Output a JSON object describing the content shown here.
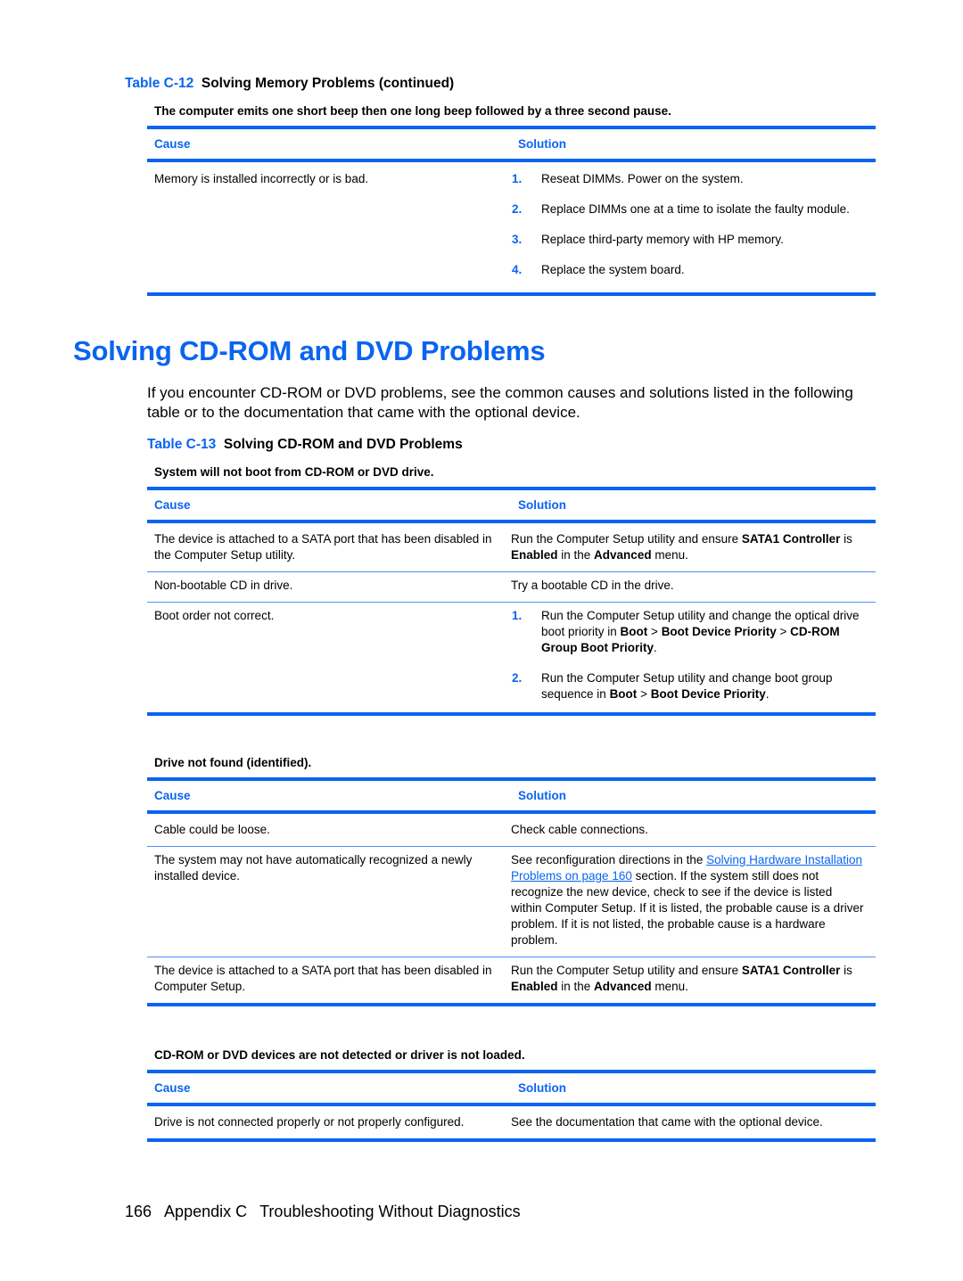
{
  "table_c12": {
    "caption_num": "Table C-12",
    "caption_title": "Solving Memory Problems (continued)",
    "subtitle": "The computer emits one short beep then one long beep followed by a three second pause.",
    "header": {
      "cause": "Cause",
      "solution": "Solution"
    },
    "row": {
      "cause": "Memory is installed incorrectly or is bad.",
      "steps": [
        {
          "n": "1.",
          "text": "Reseat DIMMs. Power on the system."
        },
        {
          "n": "2.",
          "text": "Replace DIMMs one at a time to isolate the faulty module."
        },
        {
          "n": "3.",
          "text": "Replace third-party memory with HP memory."
        },
        {
          "n": "4.",
          "text": "Replace the system board."
        }
      ]
    }
  },
  "section": {
    "title": "Solving CD-ROM and DVD Problems",
    "intro": "If you encounter CD-ROM or DVD problems, see the common causes and solutions listed in the following table or to the documentation that came with the optional device."
  },
  "table_c13": {
    "caption_num": "Table C-13",
    "caption_title": "Solving CD-ROM and DVD Problems",
    "groups": [
      {
        "subtitle": "System will not boot from CD-ROM or DVD drive.",
        "header": {
          "cause": "Cause",
          "solution": "Solution"
        },
        "rows": [
          {
            "cause": "The device is attached to a SATA port that has been disabled in the Computer Setup utility.",
            "sol": {
              "a": "Run the Computer Setup utility and ensure ",
              "b1": "SATA1 Controller",
              "c": " is ",
              "b2": "Enabled",
              "d": " in the ",
              "b3": "Advanced",
              "e": " menu."
            }
          },
          {
            "cause": "Non-bootable CD in drive.",
            "solution": "Try a bootable CD in the drive."
          },
          {
            "cause": "Boot order not correct.",
            "steps": [
              {
                "n": "1.",
                "a": "Run the Computer Setup utility and change the optical drive boot priority in ",
                "b1": "Boot",
                "sep1": " > ",
                "b2": "Boot Device Priority",
                "sep2": " > ",
                "b3": "CD-ROM Group Boot Priority",
                "end": "."
              },
              {
                "n": "2.",
                "a": "Run the Computer Setup utility and change boot group sequence in ",
                "b1": "Boot",
                "sep1": " > ",
                "b2": "Boot Device Priority",
                "end": "."
              }
            ]
          }
        ]
      },
      {
        "subtitle": "Drive not found (identified).",
        "header": {
          "cause": "Cause",
          "solution": "Solution"
        },
        "rows": [
          {
            "cause": "Cable could be loose.",
            "solution": "Check cable connections."
          },
          {
            "cause": "The system may not have automatically recognized a newly installed device.",
            "sol": {
              "a": "See reconfiguration directions in the ",
              "link": "Solving Hardware Installation Problems on page 160",
              "b": " section. If the system still does not recognize the new device, check to see if the device is listed within Computer Setup. If it is listed, the probable cause is a driver problem. If it is not listed, the probable cause is a hardware problem."
            }
          },
          {
            "cause": "The device is attached to a SATA port that has been disabled in Computer Setup.",
            "sol": {
              "a": "Run the Computer Setup utility and ensure ",
              "b1": "SATA1 Controller",
              "c": " is ",
              "b2": "Enabled",
              "d": " in the ",
              "b3": "Advanced",
              "e": " menu."
            }
          }
        ]
      },
      {
        "subtitle": "CD-ROM or DVD devices are not detected or driver is not loaded.",
        "header": {
          "cause": "Cause",
          "solution": "Solution"
        },
        "rows": [
          {
            "cause": "Drive is not connected properly or not properly configured.",
            "solution": "See the documentation that came with the optional device."
          }
        ]
      }
    ]
  },
  "footer": {
    "page_number": "166",
    "chapter": "Appendix C",
    "chapter_title": "Troubleshooting Without Diagnostics"
  }
}
